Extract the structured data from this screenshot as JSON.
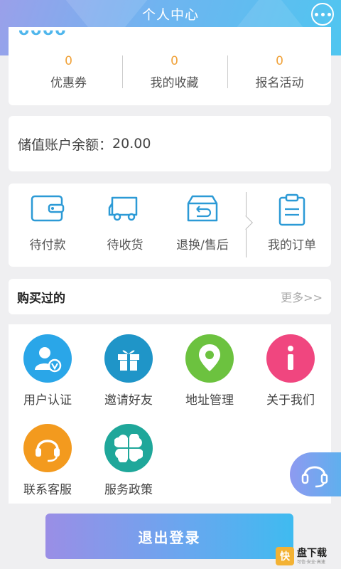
{
  "header": {
    "title": "个人中心",
    "more_icon": "more-dots-icon"
  },
  "stats": [
    {
      "value": "0",
      "label": "优惠券"
    },
    {
      "value": "0",
      "label": "我的收藏"
    },
    {
      "value": "0",
      "label": "报名活动"
    }
  ],
  "balance": {
    "label": "储值账户余额：",
    "value": "20.00"
  },
  "orders": [
    {
      "label": "待付款",
      "icon": "wallet-icon"
    },
    {
      "label": "待收货",
      "icon": "truck-icon"
    },
    {
      "label": "退换/售后",
      "icon": "return-box-icon"
    },
    {
      "label": "我的订单",
      "icon": "clipboard-icon"
    }
  ],
  "bought": {
    "title": "购买过的",
    "more": "更多>>"
  },
  "services": [
    {
      "label": "用户认证",
      "icon": "user-verify-icon",
      "color": "#2aa6e8"
    },
    {
      "label": "邀请好友",
      "icon": "gift-icon",
      "color": "#1f95c8"
    },
    {
      "label": "地址管理",
      "icon": "location-pin-icon",
      "color": "#6cc23f"
    },
    {
      "label": "关于我们",
      "icon": "info-icon",
      "color": "#f0467f"
    },
    {
      "label": "联系客服",
      "icon": "headset-icon",
      "color": "#f39a1e"
    },
    {
      "label": "服务政策",
      "icon": "clover-icon",
      "color": "#1fa79a"
    }
  ],
  "logout_label": "退出登录",
  "watermark": {
    "mark": "快",
    "title": "盘下载",
    "sub": "可信·安全·高速"
  },
  "colors": {
    "accent": "#4fb6ec",
    "count": "#f0a23a"
  }
}
